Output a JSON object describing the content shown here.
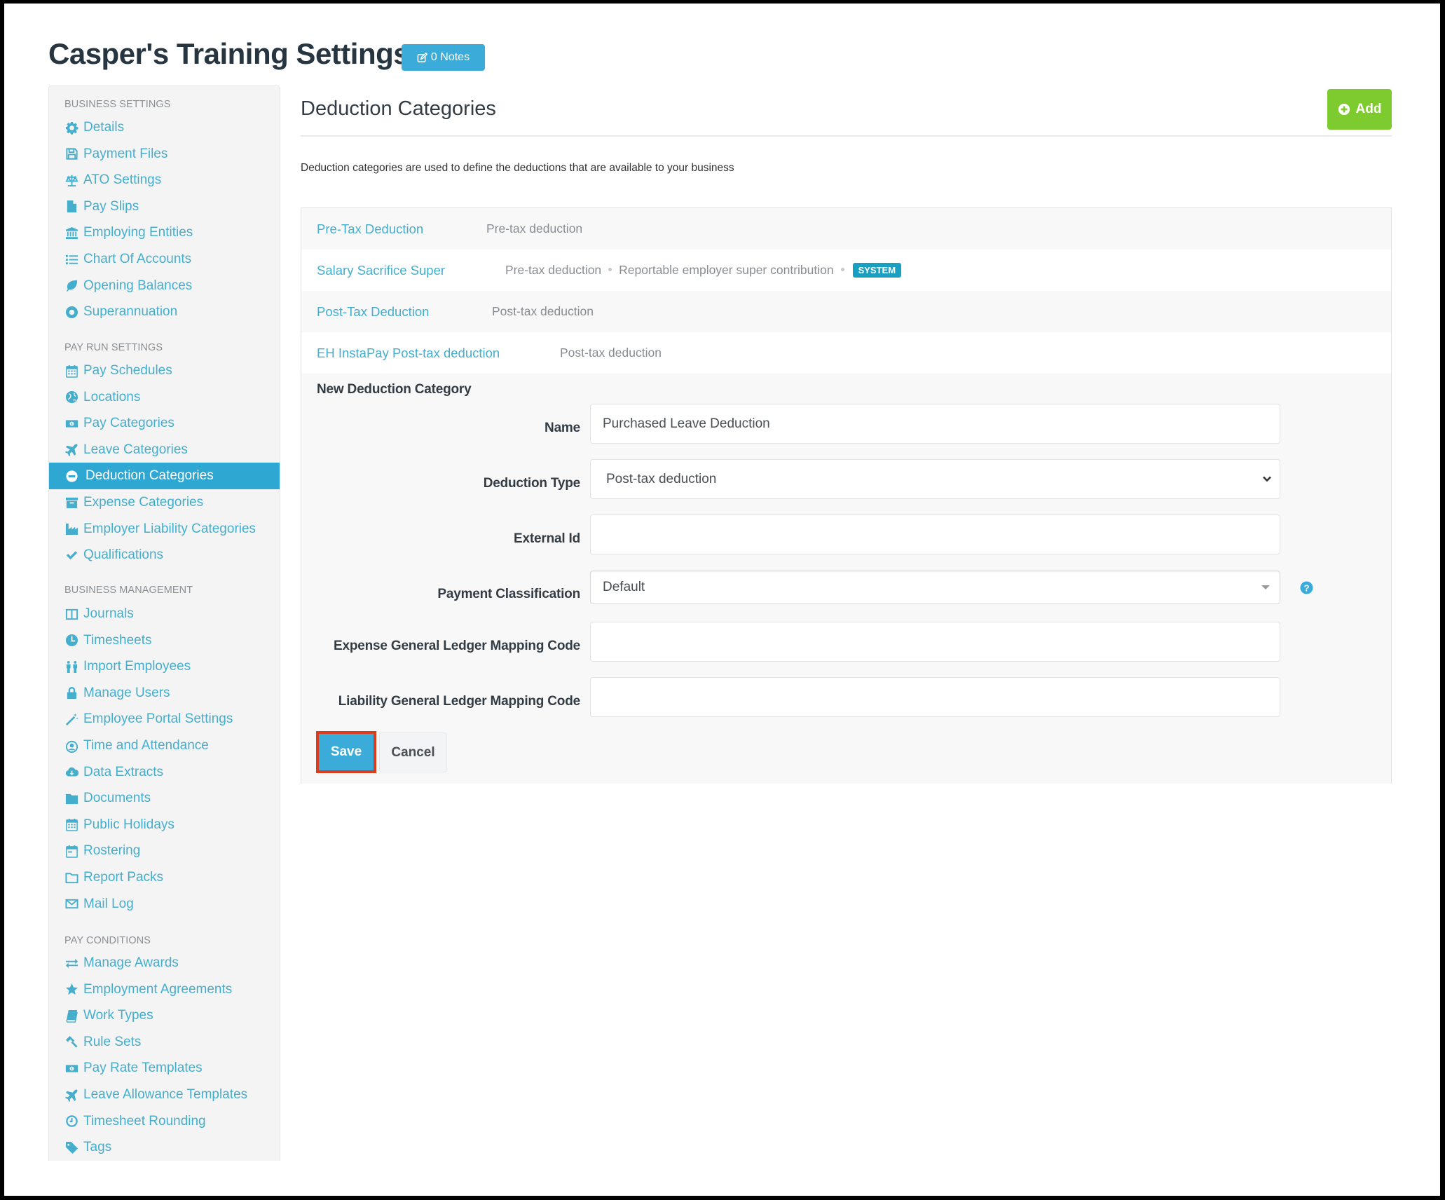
{
  "page": {
    "title": "Casper's Training Settings",
    "notes_badge": "0 Notes"
  },
  "sidebar": {
    "sections": [
      {
        "header": "BUSINESS SETTINGS",
        "items": [
          {
            "label": "Details",
            "icon": "gear-icon"
          },
          {
            "label": "Payment Files",
            "icon": "floppy-disk-icon"
          },
          {
            "label": "ATO Settings",
            "icon": "balance-scale-icon"
          },
          {
            "label": "Pay Slips",
            "icon": "file-icon"
          },
          {
            "label": "Employing Entities",
            "icon": "bank-icon"
          },
          {
            "label": "Chart Of Accounts",
            "icon": "list-icon"
          },
          {
            "label": "Opening Balances",
            "icon": "leaf-icon"
          },
          {
            "label": "Superannuation",
            "icon": "life-ring-icon"
          }
        ]
      },
      {
        "header": "PAY RUN SETTINGS",
        "items": [
          {
            "label": "Pay Schedules",
            "icon": "calendar-icon"
          },
          {
            "label": "Locations",
            "icon": "globe-icon"
          },
          {
            "label": "Pay Categories",
            "icon": "money-icon"
          },
          {
            "label": "Leave Categories",
            "icon": "plane-icon"
          },
          {
            "label": "Deduction Categories",
            "icon": "minus-circle-icon",
            "active": true
          },
          {
            "label": "Expense Categories",
            "icon": "archive-icon"
          },
          {
            "label": "Employer Liability Categories",
            "icon": "industry-icon"
          },
          {
            "label": "Qualifications",
            "icon": "check-icon"
          }
        ]
      },
      {
        "header": "BUSINESS MANAGEMENT",
        "items": [
          {
            "label": "Journals",
            "icon": "columns-icon"
          },
          {
            "label": "Timesheets",
            "icon": "clock-icon"
          },
          {
            "label": "Import Employees",
            "icon": "users-icon"
          },
          {
            "label": "Manage Users",
            "icon": "lock-icon"
          },
          {
            "label": "Employee Portal Settings",
            "icon": "magic-wand-icon"
          },
          {
            "label": "Time and Attendance",
            "icon": "user-clock-icon"
          },
          {
            "label": "Data Extracts",
            "icon": "cloud-download-icon"
          },
          {
            "label": "Documents",
            "icon": "folder-icon"
          },
          {
            "label": "Public Holidays",
            "icon": "calendar-icon"
          },
          {
            "label": "Rostering",
            "icon": "calendar-alt-icon"
          },
          {
            "label": "Report Packs",
            "icon": "folder-open-icon"
          },
          {
            "label": "Mail Log",
            "icon": "envelope-icon"
          }
        ]
      },
      {
        "header": "PAY CONDITIONS",
        "items": [
          {
            "label": "Manage Awards",
            "icon": "exchange-icon"
          },
          {
            "label": "Employment Agreements",
            "icon": "star-icon"
          },
          {
            "label": "Work Types",
            "icon": "book-icon"
          },
          {
            "label": "Rule Sets",
            "icon": "gavel-icon"
          },
          {
            "label": "Pay Rate Templates",
            "icon": "money-icon"
          },
          {
            "label": "Leave Allowance Templates",
            "icon": "plane-icon"
          },
          {
            "label": "Timesheet Rounding",
            "icon": "clock-outline-icon"
          },
          {
            "label": "Tags",
            "icon": "tag-icon"
          }
        ]
      }
    ]
  },
  "main": {
    "heading": "Deduction Categories",
    "add_button": "Add",
    "description": "Deduction categories are used to define the deductions that are available to your business",
    "categories": [
      {
        "name": "Pre-Tax Deduction",
        "meta": [
          "Pre-tax deduction"
        ],
        "badge": null
      },
      {
        "name": "Salary Sacrifice Super",
        "meta": [
          "Pre-tax deduction",
          "Reportable employer super contribution"
        ],
        "badge": "SYSTEM"
      },
      {
        "name": "Post-Tax Deduction",
        "meta": [
          "Post-tax deduction"
        ],
        "badge": null
      },
      {
        "name": "EH InstaPay Post-tax deduction",
        "meta": [
          "Post-tax deduction"
        ],
        "badge": null
      }
    ],
    "form": {
      "title": "New Deduction Category",
      "fields": {
        "name": {
          "label": "Name",
          "value": "Purchased Leave Deduction"
        },
        "deduction_type": {
          "label": "Deduction Type",
          "value": "Post-tax deduction"
        },
        "external_id": {
          "label": "External Id",
          "value": ""
        },
        "payment_classification": {
          "label": "Payment Classification",
          "value": "Default"
        },
        "expense_gl": {
          "label": "Expense General Ledger Mapping Code",
          "value": ""
        },
        "liability_gl": {
          "label": "Liability General Ledger Mapping Code",
          "value": ""
        }
      },
      "save_label": "Save",
      "cancel_label": "Cancel"
    }
  },
  "colors": {
    "accent": "#3bacd9",
    "link": "#45aecd",
    "add_green": "#7dcb2f",
    "system_badge": "#1b9fc1",
    "highlight_border": "#dc3b1c"
  }
}
